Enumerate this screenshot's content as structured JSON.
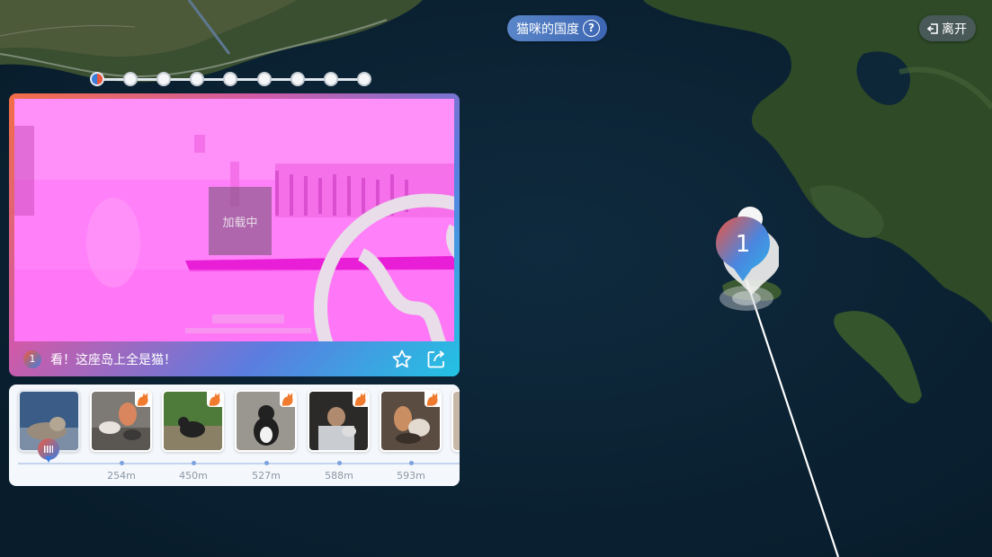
{
  "header": {
    "title": "猫咪的国度",
    "help_icon": "question-circle-icon",
    "leave_label": "离开",
    "leave_icon": "exit-icon"
  },
  "pager": {
    "count": 9,
    "active_index": 0
  },
  "video": {
    "loading_label": "加载中",
    "loading_icon": "loading-earth-icon"
  },
  "caption_bar": {
    "badge": "1",
    "text": "看！这座岛上全是猫！",
    "favorite_icon": "star-icon",
    "share_icon": "share-icon"
  },
  "filmstrip": {
    "items": [
      {
        "name": "thumb-current",
        "distance": ""
      },
      {
        "name": "thumb-254m",
        "distance": "254m"
      },
      {
        "name": "thumb-450m",
        "distance": "450m"
      },
      {
        "name": "thumb-527m",
        "distance": "527m"
      },
      {
        "name": "thumb-588m",
        "distance": "588m"
      },
      {
        "name": "thumb-593m",
        "distance": "593m"
      }
    ]
  },
  "map_marker": {
    "label": "1"
  },
  "colors": {
    "ocean": "#0b2436",
    "land": "#2d4a28",
    "accent_red": "#ef5a3f",
    "accent_blue": "#3a7cd9",
    "video_overlay": "#ff7ff8"
  }
}
